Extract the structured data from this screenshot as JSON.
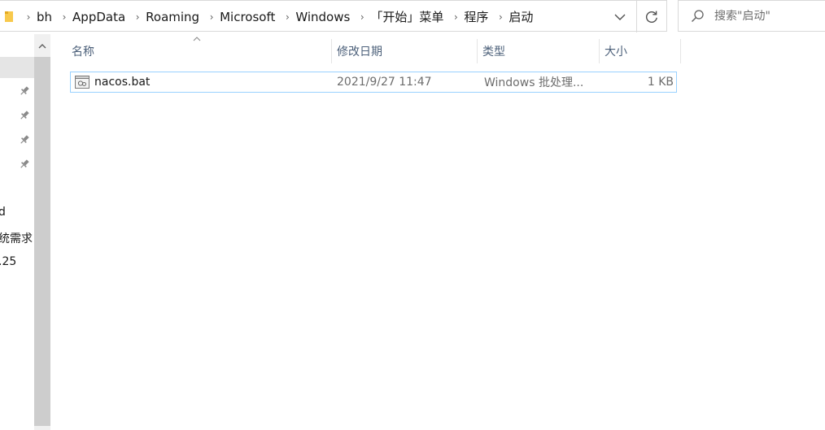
{
  "address_bar": {
    "breadcrumb": [
      "bh",
      "AppData",
      "Roaming",
      "Microsoft",
      "Windows",
      "「开始」菜单",
      "程序",
      "启动"
    ],
    "separator_icon": "chevron-right-icon",
    "folder_icon": "folder-icon",
    "dropdown_icon": "chevron-down-icon",
    "refresh_icon": "refresh-icon"
  },
  "search": {
    "placeholder": "搜索\"启动\"",
    "value": "",
    "icon": "search-icon"
  },
  "navigation": {
    "pinned_icon": "pin-icon",
    "visible_texts": [
      "d",
      "统需求",
      ".25"
    ]
  },
  "file_list": {
    "columns": {
      "name": "名称",
      "date": "修改日期",
      "type": "类型",
      "size": "大小"
    },
    "sort_column": "name",
    "rows": [
      {
        "name": "nacos.bat",
        "date": "2021/9/27 11:47",
        "type": "Windows 批处理...",
        "size": "1 KB",
        "icon": "batch-file-icon"
      }
    ]
  },
  "colors": {
    "accent_selection_border": "#99d1ff",
    "header_text": "#4c607a",
    "secondary_text": "#6d6d6d",
    "scrollbar_thumb": "#cdcdcd",
    "folder_yellow": "#f8c94c"
  }
}
